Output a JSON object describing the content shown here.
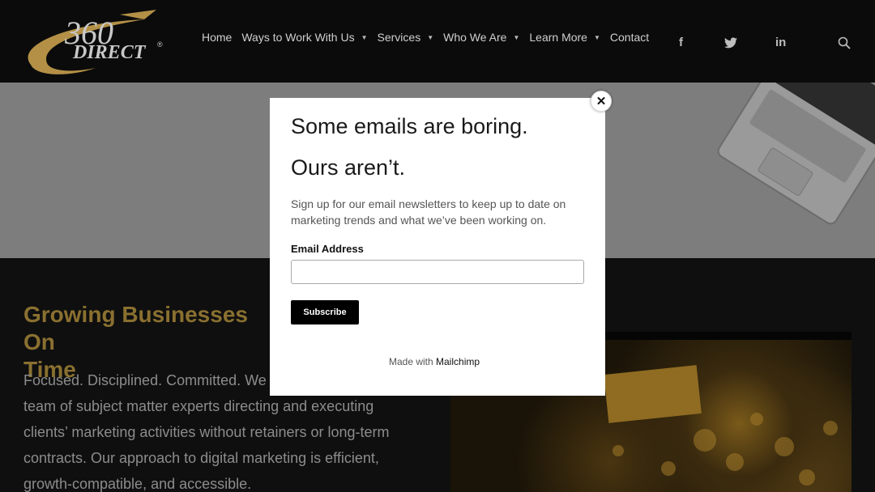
{
  "brand": {
    "logo_number": "360",
    "logo_word": "DIRECT",
    "logo_mark": "®",
    "logo_color": "#b39046"
  },
  "nav": {
    "items": [
      {
        "label": "Home",
        "dropdown": false
      },
      {
        "label": "Ways to Work With Us",
        "dropdown": true
      },
      {
        "label": "Services",
        "dropdown": true
      },
      {
        "label": "Who We Are",
        "dropdown": true
      },
      {
        "label": "Learn More",
        "dropdown": true
      },
      {
        "label": "Contact",
        "dropdown": false
      }
    ],
    "caret": "▼"
  },
  "social": {
    "facebook": "f",
    "twitter": "twitter-icon",
    "linkedin": "in"
  },
  "section": {
    "headline_line1": "Growing Businesses On",
    "headline_line2": "Time",
    "body_lines": [
      "Focused. Disciplined. Committed. We",
      "team of subject matter experts directing and executing",
      "clients’ marketing activities without retainers or long-term",
      "contracts. Our approach to digital marketing is efficient,",
      "growth-compatible, and accessible."
    ]
  },
  "modal": {
    "title_line1": "Some emails are boring.",
    "title_line2": "Ours aren’t.",
    "description": "Sign up for our email newsletters to keep up to date on marketing trends and what we’ve been working on.",
    "field_label": "Email Address",
    "email_value": "",
    "subscribe_label": "Subscribe",
    "made_with_prefix": "Made with",
    "made_with_brand": "Mailchimp",
    "close_symbol": "✕"
  }
}
